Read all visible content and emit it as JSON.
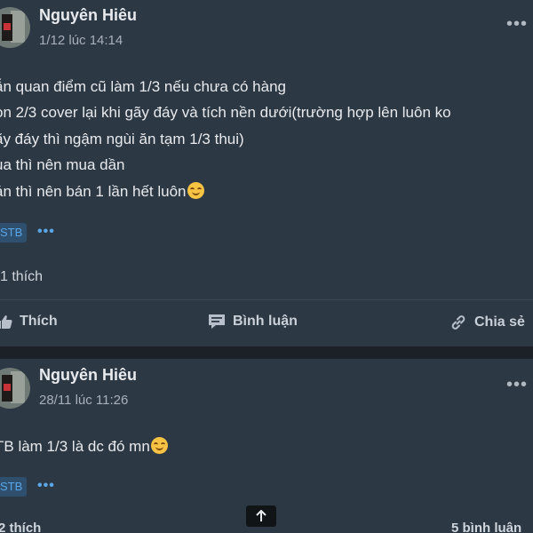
{
  "posts": [
    {
      "author": "Nguyên Hiêu",
      "time": "1/12 lúc 14:14",
      "lines": [
        "ẫn quan điểm cũ làm 1/3 nếu chưa có hàng",
        "on 2/3 cover lại khi gãy đáy và tích nền dưới(trường hợp lên luôn ko",
        "ãy đáy thì ngậm ngùi ăn tạm 1/3 thui)",
        "ua thì nên mua dần",
        "án thì nên bán 1 lần hết luôn"
      ],
      "tag": "STB",
      "tag_more": "•••",
      "likes": "1 thích",
      "actions": {
        "like": "Thích",
        "comment": "Bình luận",
        "share": "Chia sẻ"
      }
    },
    {
      "author": "Nguyên Hiêu",
      "time": "28/11 lúc 11:26",
      "lines": [
        "TB làm 1/3 là dc đó mn"
      ],
      "tag": "STB",
      "tag_more": "•••",
      "likes": "2 thích",
      "comments_count": "5 bình luận"
    }
  ],
  "more_icon": "•••",
  "icons": {
    "more": "more-horizontal-icon",
    "scroll_top": "arrow-up-icon",
    "like": "thumbs-up-icon",
    "comment": "comment-icon",
    "share": "link-icon"
  }
}
